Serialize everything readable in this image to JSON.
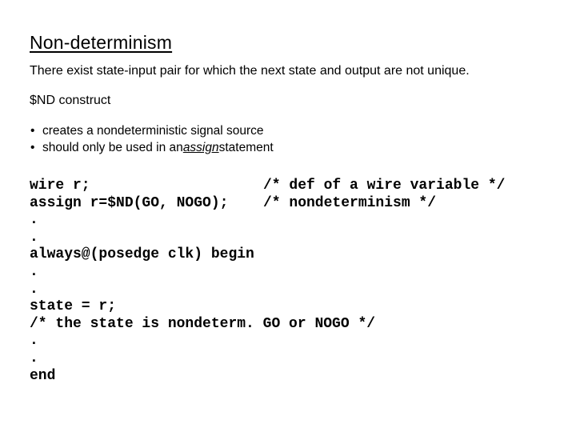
{
  "slide": {
    "title": "Non-determinism",
    "definition": "There exist state-input pair for which the next state and output are not unique.",
    "construct_heading": "$ND construct",
    "bullets": [
      {
        "mark": "•",
        "before": "creates a nondeterministic signal source",
        "keyword": "",
        "after": ""
      },
      {
        "mark": "•",
        "before": "should only be used in an ",
        "keyword": "assign",
        "after": " statement"
      }
    ],
    "code": [
      {
        "stmt": "wire r;",
        "comment": "/* def of a wire variable */"
      },
      {
        "stmt": "assign r=$ND(GO, NOGO);",
        "comment": "/* nondeterminism */"
      },
      {
        "stmt": ".",
        "comment": ""
      },
      {
        "stmt": ".",
        "comment": ""
      },
      {
        "stmt": "always@(posedge clk) begin",
        "comment": ""
      },
      {
        "stmt": ".",
        "comment": ""
      },
      {
        "stmt": ".",
        "comment": ""
      },
      {
        "stmt": "state = r;",
        "comment": ""
      },
      {
        "stmt": "/* the state is nondeterm. GO or NOGO */",
        "comment": ""
      },
      {
        "stmt": ".",
        "comment": ""
      },
      {
        "stmt": ".",
        "comment": ""
      },
      {
        "stmt": "end",
        "comment": ""
      }
    ]
  }
}
